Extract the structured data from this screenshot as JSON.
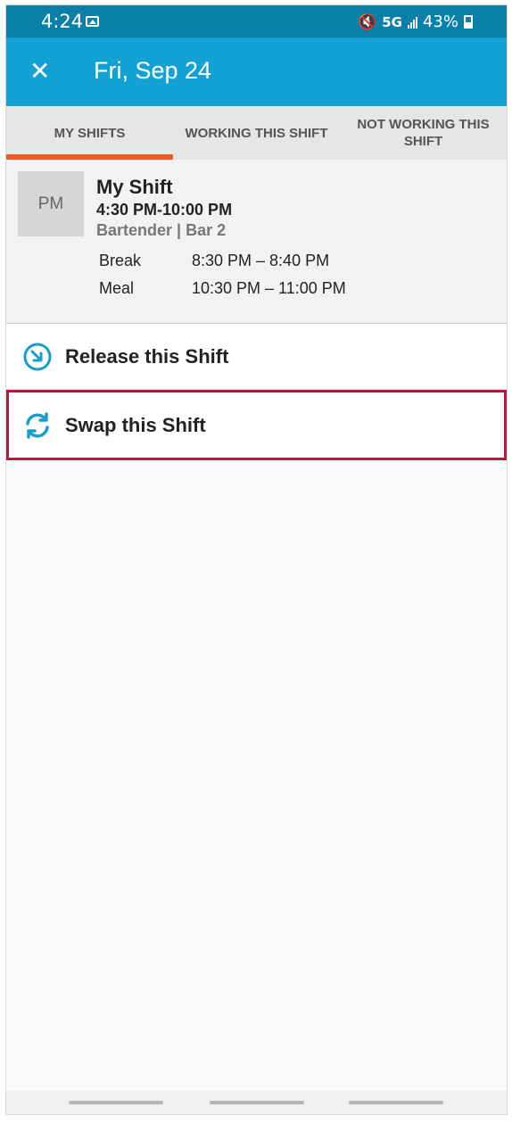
{
  "status_bar": {
    "time": "4:24",
    "network": "5G",
    "battery": "43%",
    "icons": [
      "image-icon",
      "mute-icon",
      "signal-icon",
      "battery-icon"
    ]
  },
  "app_bar": {
    "close_icon": "close-icon",
    "title": "Fri, Sep 24",
    "color": "#13a1d3"
  },
  "tabs": [
    {
      "label": "MY SHIFTS",
      "active": true
    },
    {
      "label": "WORKING THIS SHIFT",
      "active": false
    },
    {
      "label": "NOT WORKING THIS SHIFT",
      "active": false
    }
  ],
  "accent_color": "#f15a24",
  "shift": {
    "badge": "PM",
    "title": "My Shift",
    "time": "4:30 PM-10:00 PM",
    "role": "Bartender | Bar 2",
    "details": [
      {
        "label": "Break",
        "value": "8:30 PM – 8:40 PM"
      },
      {
        "label": "Meal",
        "value": "10:30 PM – 11:00 PM"
      }
    ]
  },
  "actions": {
    "release": {
      "label": "Release this Shift",
      "icon": "release-icon"
    },
    "swap": {
      "label": "Swap this Shift",
      "icon": "swap-icon",
      "highlight_color": "#c4133b"
    }
  }
}
